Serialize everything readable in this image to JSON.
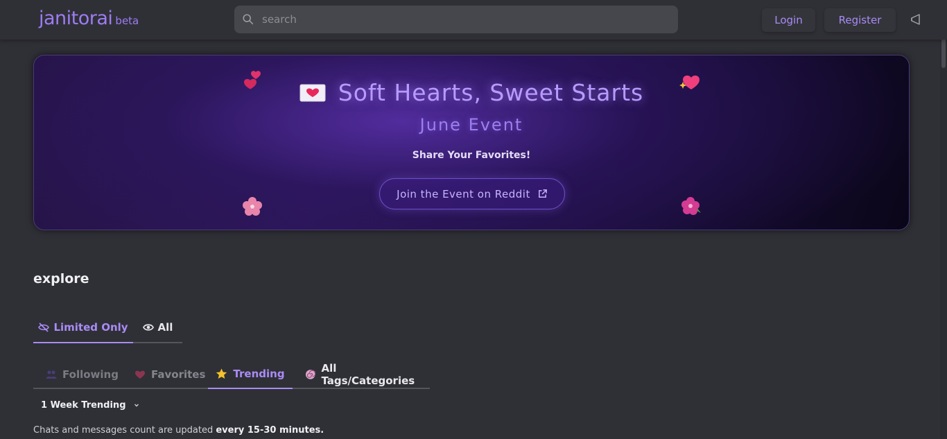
{
  "header": {
    "logo_name": "janitorai",
    "logo_badge": "beta",
    "search_placeholder": "search",
    "search_value": "",
    "login_label": "Login",
    "register_label": "Register"
  },
  "banner": {
    "title": "Soft Hearts, Sweet Starts",
    "subtitle": "June Event",
    "tagline": "Share Your Favorites!",
    "cta_label": "Join the Event on Reddit"
  },
  "explore": {
    "title": "explore",
    "view_tabs": [
      {
        "label": "Limited Only",
        "icon": "eye-slash-icon",
        "active": true
      },
      {
        "label": "All",
        "icon": "eye-icon",
        "active": false
      }
    ],
    "category_tabs": [
      {
        "label": "Following",
        "icon": "users-icon",
        "active": false
      },
      {
        "label": "Favorites",
        "icon": "heart-icon",
        "active": false
      },
      {
        "label": "Trending",
        "icon": "star-icon",
        "active": true
      },
      {
        "label": "All Tags/Categories",
        "icon": "swirl-icon",
        "active": false
      }
    ],
    "sort_value": "1 Week Trending",
    "note_prefix": "Chats and messages count are updated ",
    "note_bold": "every 15-30 minutes."
  },
  "colors": {
    "accent": "#a98bf5",
    "background": "#2f3036",
    "search_bg": "#46474d"
  }
}
